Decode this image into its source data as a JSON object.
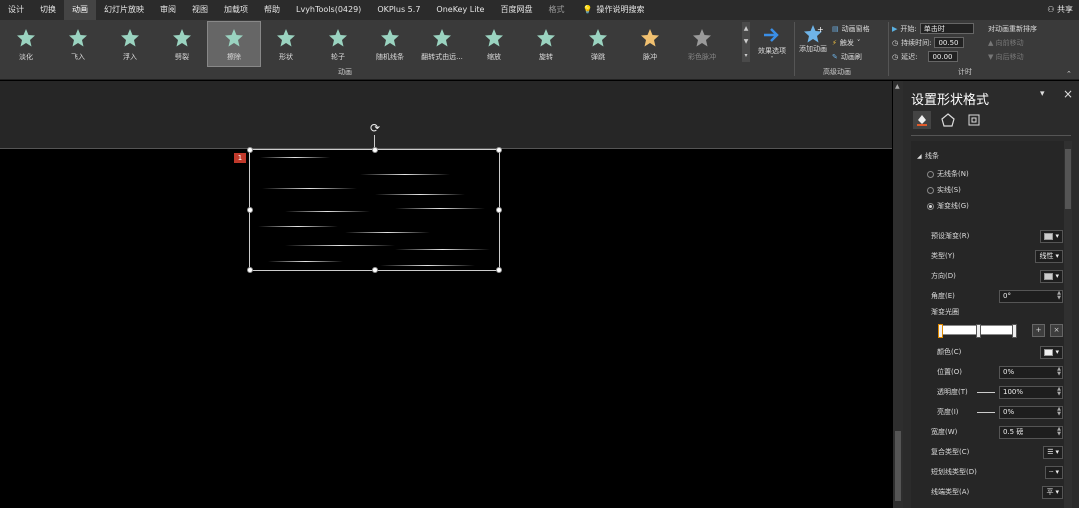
{
  "menu": {
    "items": [
      "设计",
      "切换",
      "动画",
      "幻灯片放映",
      "审阅",
      "视图",
      "加载项",
      "帮助",
      "LvyhTools(0429)",
      "OKPlus 5.7",
      "OneKey Lite",
      "百度网盘",
      "格式"
    ],
    "active_index": 2,
    "faded_index": 12,
    "tell_me": "操作说明搜索",
    "share": "共享"
  },
  "ribbon": {
    "animations": [
      {
        "label": "淡化",
        "color": "#9ad3c0"
      },
      {
        "label": "飞入",
        "color": "#9ad3c0"
      },
      {
        "label": "浮入",
        "color": "#9ad3c0"
      },
      {
        "label": "劈裂",
        "color": "#9ad3c0"
      },
      {
        "label": "擦除",
        "color": "#9ad3c0"
      },
      {
        "label": "形状",
        "color": "#9ad3c0"
      },
      {
        "label": "轮子",
        "color": "#9ad3c0"
      },
      {
        "label": "随机线条",
        "color": "#9ad3c0"
      },
      {
        "label": "翻转式由远...",
        "color": "#9ad3c0"
      },
      {
        "label": "缩放",
        "color": "#9ad3c0"
      },
      {
        "label": "旋转",
        "color": "#9ad3c0"
      },
      {
        "label": "弹跳",
        "color": "#9ad3c0"
      },
      {
        "label": "脉冲",
        "color": "#f0c070"
      },
      {
        "label": "彩色脉冲",
        "color": "#9a9a9a"
      }
    ],
    "selected_index": 4,
    "disabled_index": 13,
    "effect_options": "效果选项",
    "group_animation": "动画",
    "advanced": {
      "add_animation": "添加动画",
      "pane": "动画窗格",
      "trigger": "触发",
      "painter": "动画刷",
      "group_label": "高级动画"
    },
    "timing": {
      "start_label": "开始:",
      "start_value": "单击时",
      "duration_label": "持续时间:",
      "duration_value": "00.50",
      "delay_label": "延迟:",
      "delay_value": "00.00",
      "reorder": "对动画重新排序",
      "move_earlier": "向前移动",
      "move_later": "向后移动",
      "group_label": "计时"
    }
  },
  "canvas": {
    "anim_tag": "1"
  },
  "pane": {
    "title": "设置形状格式",
    "section": "线条",
    "radio_none": "无线条(N)",
    "radio_solid": "实线(S)",
    "radio_gradient": "渐变线(G)",
    "preset_label": "预设渐变(R)",
    "type_label": "类型(Y)",
    "type_value": "线性",
    "direction_label": "方向(D)",
    "angle_label": "角度(E)",
    "angle_value": "0°",
    "stops_label": "渐变光圈",
    "color_label": "颜色(C)",
    "position_label": "位置(O)",
    "position_value": "0%",
    "transparency_label": "透明度(T)",
    "transparency_value": "100%",
    "brightness_label": "亮度(I)",
    "brightness_value": "0%",
    "width_label": "宽度(W)",
    "width_value": "0.5 磅",
    "compound_label": "复合类型(C)",
    "dash_label": "短划线类型(D)",
    "cap_label": "线端类型(A)",
    "cap_value": "平"
  }
}
